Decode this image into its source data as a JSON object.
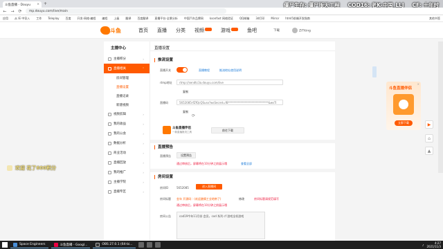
{
  "browser": {
    "tab_label": "斗鱼直播 - Douyu",
    "tab_close": "×",
    "new_tab": "+",
    "url": "mp.douyu.com/live/main",
    "nav_back": "←",
    "nav_forward": "→",
    "nav_reload": "⟳",
    "bookmarks": [
      "应用",
      "从 IE 中导入",
      "工作",
      "Teleplay",
      "百度",
      "开发-网络-编程",
      "编程",
      "上级",
      "翻译",
      "百度翻译",
      "直播平台-全景分析",
      "中国汽车品牌网",
      "ksonfast 网络验证",
      "QQ邮箱",
      "3d打印",
      "Mirror",
      "html5前端开发指南"
    ],
    "other_bookmarks": "其他书签"
  },
  "overlay": {
    "items": [
      "僵尸生存: 僵尸版天工程",
      "COD16: 老K-中国_LLJ",
      "CF: 十年时"
    ]
  },
  "site": {
    "logo_text": "斗鱼",
    "nav": [
      {
        "label": "首页"
      },
      {
        "label": "直播"
      },
      {
        "label": "分类"
      },
      {
        "label": "视频"
      },
      {
        "label": "游戏"
      },
      {
        "label": "鱼吧"
      }
    ],
    "download": "下载",
    "username": "ZiTiting"
  },
  "sidebar": {
    "title": "主播中心",
    "items": [
      {
        "label": "主播积分"
      },
      {
        "label": "直播相关",
        "active": true
      },
      {
        "label": "视频剪辑"
      },
      {
        "label": "我的收益"
      },
      {
        "label": "我的公会"
      },
      {
        "label": "数据分析"
      },
      {
        "label": "商业活动"
      },
      {
        "label": "直播回放"
      },
      {
        "label": "我的推广"
      },
      {
        "label": "主播学院"
      },
      {
        "label": "直播专区"
      }
    ],
    "sub_items": [
      {
        "label": "房间管理"
      },
      {
        "label": "直播设置",
        "active": true
      },
      {
        "label": "直播记录"
      },
      {
        "label": "新建视频"
      }
    ]
  },
  "main": {
    "title": "直播设置",
    "section_settings": "推流设置",
    "live_switch_label": "直播开关",
    "link_tutorial": "直播教程",
    "link_rtmp": "推流地址使用说明",
    "rtmp_label": "rtmp地址",
    "rtmp_value": "rtmp://sendtc3a.douyu.com/live",
    "copy_label": "复制",
    "code_label": "直播码",
    "code_value": "5652085rfZfQcQSusx?wsSecret=f8*****************************&wsTi",
    "promo_title": "斗鱼直播伴侣",
    "promo_sub": "一款直播推流工具",
    "promo_btn": "前往下载",
    "section_notice": "直播预告",
    "notice_label": "直播预告",
    "notice_btn": "设置预告",
    "notice_hint": "通过审核后，屏幕将在10分钟之前展示哦",
    "notice_link": "查看全部",
    "section_room": "房间设置",
    "room_id_label": "房间ID",
    "room_id_value": "5652085",
    "room_id_btn": "进入直播间",
    "room_title_label": "房间标题",
    "room_title_value": "金年 开源码：(欢迎激情工业地带了)",
    "room_title_edit": "修改",
    "room_title_hint": "通过审核后，屏幕将在10分钟之前展示哦",
    "room_title_warn": "房间标题请规范填写",
    "room_notice_label": "房间公告",
    "room_notice_value": "cod19今年11月份 会员，cod 系列 cf 游戏全机游戏"
  },
  "ad": {
    "title": "斗鱼直播伴侣",
    "cta": "立即下载",
    "close": "×"
  },
  "danmaku": {
    "message": "欢迎 花了600积分"
  },
  "taskbar": {
    "apps": [
      "Space Engineers",
      "斗鱼直播 - Googl...",
      "OBS 27.0.1 (64-bi..."
    ],
    "time": "4:27",
    "date": "2021/11/3"
  }
}
